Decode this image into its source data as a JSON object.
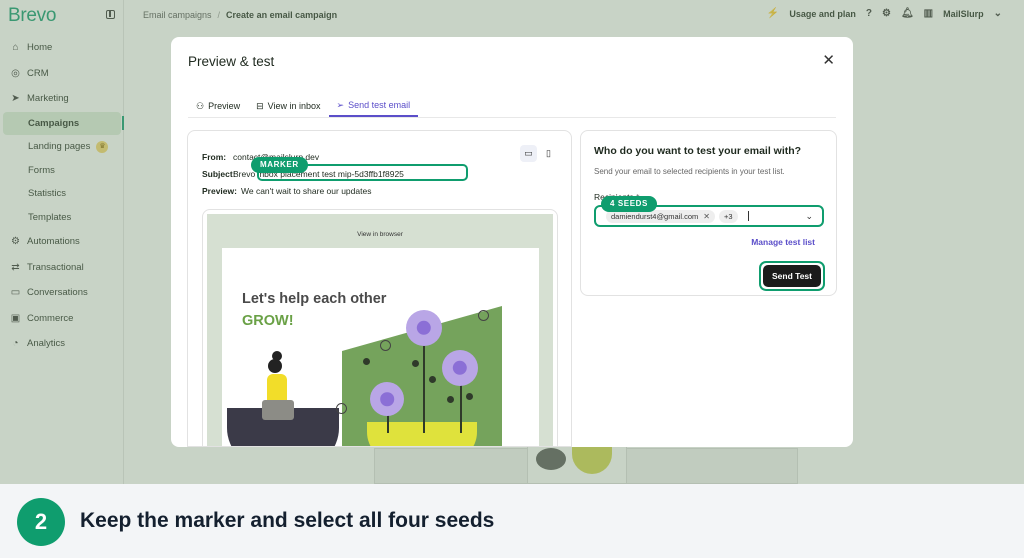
{
  "app": {
    "logo": "Brevo",
    "breadcrumb": [
      "Email campaigns",
      "Create an email campaign"
    ],
    "topbar": {
      "usage": "Usage and plan",
      "account": "MailSlurp"
    }
  },
  "sidebar": {
    "items": [
      {
        "label": "Home",
        "icon": "home-icon"
      },
      {
        "label": "CRM",
        "icon": "crm-icon"
      },
      {
        "label": "Marketing",
        "icon": "send-icon"
      },
      {
        "label": "Campaigns",
        "sub": true,
        "active": true
      },
      {
        "label": "Landing pages",
        "sub": true,
        "badge": "crown-icon"
      },
      {
        "label": "Forms",
        "sub": true
      },
      {
        "label": "Statistics",
        "sub": true
      },
      {
        "label": "Templates",
        "sub": true
      },
      {
        "label": "Automations",
        "icon": "automation-icon"
      },
      {
        "label": "Transactional",
        "icon": "transactional-icon"
      },
      {
        "label": "Conversations",
        "icon": "chat-icon"
      },
      {
        "label": "Commerce",
        "icon": "commerce-icon"
      },
      {
        "label": "Analytics",
        "icon": "analytics-icon"
      }
    ]
  },
  "modal": {
    "title": "Preview & test",
    "tabs": [
      {
        "label": "Preview",
        "icon": "users-icon"
      },
      {
        "label": "View in inbox",
        "icon": "inbox-icon"
      },
      {
        "label": "Send test email",
        "icon": "send-icon",
        "active": true
      }
    ],
    "preview": {
      "from_label": "From:",
      "from_value": "contact@mailslurp.dev",
      "subject_label": "Subject:",
      "subject_value": "Brevo inbox placement test mip-5d3ffb1f8925",
      "preview_label": "Preview:",
      "preview_value": "We can't wait to share our updates",
      "view_in_browser": "View in browser",
      "headline_1": "Let's help each other",
      "headline_2": "GROW!"
    },
    "test": {
      "title": "Who do you want to test your email with?",
      "subtitle": "Send your email to selected recipients in your test list.",
      "recipients_label": "Recipients",
      "recipients_required": "*",
      "chip_email": "damiendurst4@gmail.com",
      "chip_more": "+3",
      "manage": "Manage test list",
      "send": "Send Test"
    }
  },
  "annotations": {
    "marker_badge": "MARKER",
    "seeds_badge": "4 SEEDS",
    "accent": "#0f9d6e"
  },
  "caption": {
    "step": "2",
    "text": "Keep the marker and select all four seeds"
  }
}
